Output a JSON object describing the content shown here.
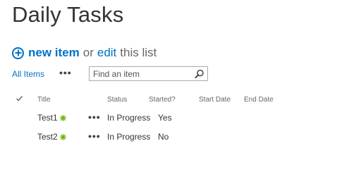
{
  "page": {
    "title": "Daily Tasks"
  },
  "actions": {
    "new_item": "new item",
    "or_text": "or",
    "edit": "edit",
    "this_list": "this list"
  },
  "views": {
    "all_items": "All Items",
    "more": "•••"
  },
  "search": {
    "placeholder": "Find an item",
    "icon": "magnifier-icon"
  },
  "columns": {
    "select_icon": "checkmark-icon",
    "title": "Title",
    "status": "Status",
    "started": "Started?",
    "start_date": "Start Date",
    "end_date": "End Date"
  },
  "items": [
    {
      "title": "Test1",
      "new_badge_icon": "new-item-badge-icon",
      "menu": "•••",
      "status": "In Progress",
      "started": "Yes",
      "start_date": "",
      "end_date": ""
    },
    {
      "title": "Test2",
      "new_badge_icon": "new-item-badge-icon",
      "menu": "•••",
      "status": "In Progress",
      "started": "No",
      "start_date": "",
      "end_date": ""
    }
  ],
  "colors": {
    "accent": "#0072c6",
    "badge": "#6bb700",
    "text": "#333333",
    "muted": "#666666"
  }
}
